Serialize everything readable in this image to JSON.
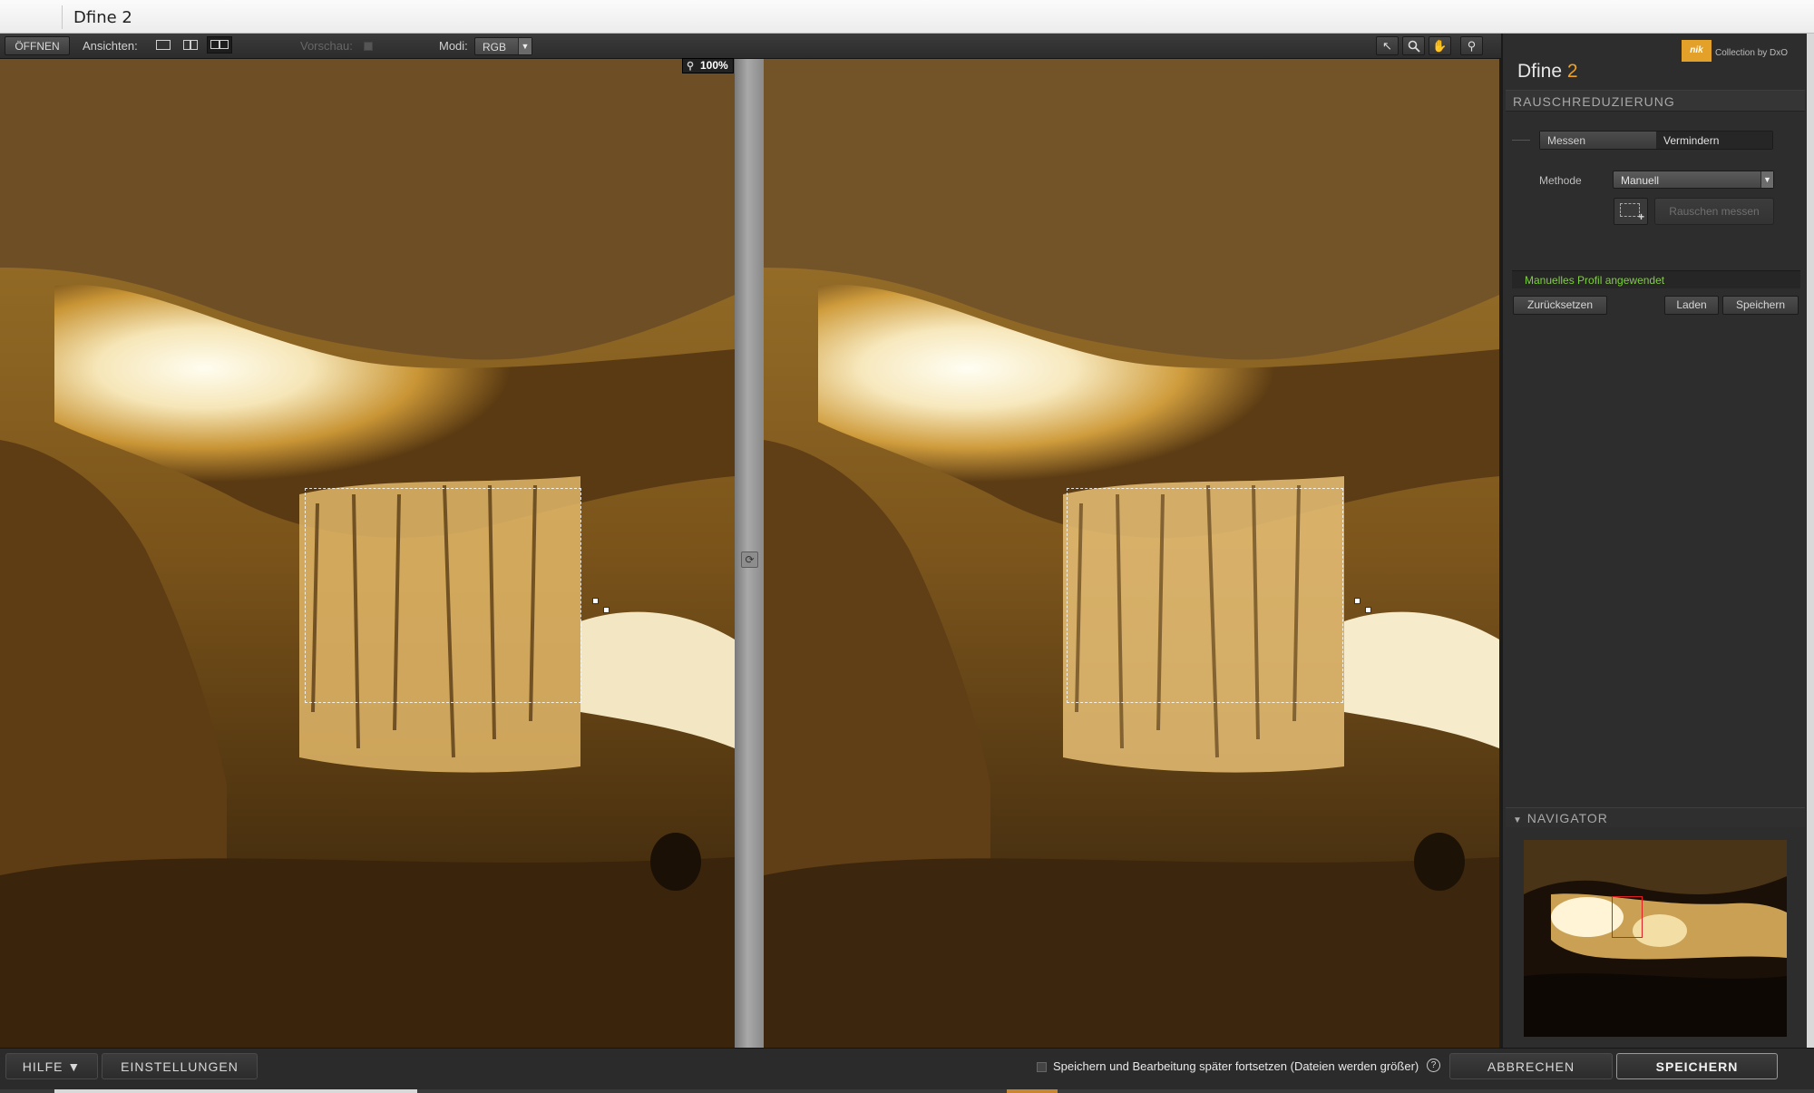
{
  "window": {
    "title": "Dfine 2"
  },
  "toolbar": {
    "open_label": "ÖFFNEN",
    "views_label": "Ansichten:",
    "preview_label": "Vorschau:",
    "mode_label": "Modi:",
    "mode_value": "RGB"
  },
  "viewer": {
    "zoom": "100%"
  },
  "panel": {
    "logo_text": "nik",
    "logo_caption": "Collection by DxO",
    "app_name": "Dfine",
    "app_version": "2",
    "section_title": "RAUSCHREDUZIERUNG",
    "tabs": [
      {
        "label": "Messen"
      },
      {
        "label": "Vermindern"
      }
    ],
    "method_label": "Methode",
    "method_value": "Manuell",
    "measure_button": "Rauschen messen",
    "status_text": "Manuelles Profil angewendet",
    "reset_button": "Zurücksetzen",
    "load_button": "Laden",
    "save_button": "Speichern",
    "navigator_title": "NAVIGATOR"
  },
  "bottom": {
    "help_label": "HILFE ▼",
    "settings_label": "EINSTELLUNGEN",
    "continue_text": "Speichern und Bearbeitung später fortsetzen (Dateien werden größer)",
    "help_icon": "?",
    "cancel_label": "ABBRECHEN",
    "save_label": "SPEICHERN"
  },
  "colors": {
    "accent": "#f0a020",
    "status_green": "#7cd23a",
    "nav_rect": "#e02020"
  }
}
